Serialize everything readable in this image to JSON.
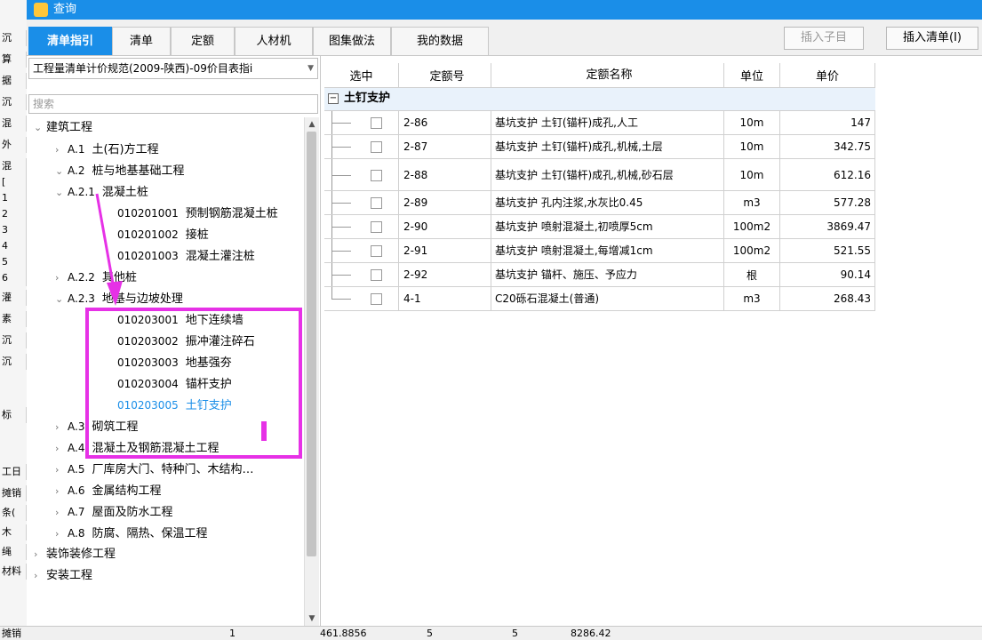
{
  "background": {
    "left_fragments": [
      "沉",
      "算",
      "据",
      "沉",
      "混",
      "外",
      "混",
      "[",
      "1",
      "2",
      "3",
      "4",
      "5",
      "6",
      "灌",
      "素",
      "沉",
      "沉",
      "标",
      "工日",
      "摊销",
      "条(",
      "木",
      "绳",
      "材料"
    ],
    "bottom_row": [
      "摊销",
      "1",
      "461.8856",
      "5",
      "5",
      "8286.42"
    ]
  },
  "dialog": {
    "title": "查询",
    "tabs": [
      "清单指引",
      "清单",
      "定额",
      "人材机",
      "图集做法",
      "我的数据"
    ],
    "active_tab": "清单指引",
    "buttons": {
      "insert_child": "插入子目",
      "insert_list": "插入清单(I)"
    },
    "accent_color": "#1a8ee8",
    "highlight_color": "#e631e6"
  },
  "left": {
    "spec_selected": "工程量清单计价规范(2009-陕西)-09价目表指i",
    "search_placeholder": "搜索",
    "tree": [
      {
        "chev": "⌄",
        "code": "",
        "label": "建筑工程"
      },
      {
        "chev": "›",
        "code": "A.1",
        "label": "土(石)方工程"
      },
      {
        "chev": "⌄",
        "code": "A.2",
        "label": "桩与地基基础工程"
      },
      {
        "chev": "⌄",
        "code": "A.2.1",
        "label": "混凝土桩"
      },
      {
        "chev": "",
        "code": "010201001",
        "label": "预制钢筋混凝土桩"
      },
      {
        "chev": "",
        "code": "010201002",
        "label": "接桩"
      },
      {
        "chev": "",
        "code": "010201003",
        "label": "混凝土灌注桩"
      },
      {
        "chev": "›",
        "code": "A.2.2",
        "label": "其他桩"
      },
      {
        "chev": "⌄",
        "code": "A.2.3",
        "label": "地基与边坡处理"
      },
      {
        "chev": "",
        "code": "010203001",
        "label": "地下连续墙"
      },
      {
        "chev": "",
        "code": "010203002",
        "label": "振冲灌注碎石"
      },
      {
        "chev": "",
        "code": "010203003",
        "label": "地基强夯"
      },
      {
        "chev": "",
        "code": "010203004",
        "label": "锚杆支护"
      },
      {
        "chev": "",
        "code": "010203005",
        "label": "土钉支护"
      },
      {
        "chev": "›",
        "code": "A.3",
        "label": "砌筑工程"
      },
      {
        "chev": "›",
        "code": "A.4",
        "label": "混凝土及钢筋混凝土工程"
      },
      {
        "chev": "›",
        "code": "A.5",
        "label": "厂库房大门、特种门、木结构…"
      },
      {
        "chev": "›",
        "code": "A.6",
        "label": "金属结构工程"
      },
      {
        "chev": "›",
        "code": "A.7",
        "label": "屋面及防水工程"
      },
      {
        "chev": "›",
        "code": "A.8",
        "label": "防腐、隔热、保温工程"
      },
      {
        "chev": "›",
        "code": "",
        "label": "装饰装修工程"
      },
      {
        "chev": "›",
        "code": "",
        "label": "安装工程"
      }
    ]
  },
  "table": {
    "headers": [
      "选中",
      "定额号",
      "定额名称",
      "单位",
      "单价"
    ],
    "group": "土钉支护",
    "rows": [
      {
        "code": "2-86",
        "name": "基坑支护 土钉(锚杆)成孔,人工",
        "unit": "10m",
        "price": "147"
      },
      {
        "code": "2-87",
        "name": "基坑支护 土钉(锚杆)成孔,机械,土层",
        "unit": "10m",
        "price": "342.75"
      },
      {
        "code": "2-88",
        "name": "基坑支护 土钉(锚杆)成孔,机械,砂石层",
        "unit": "10m",
        "price": "612.16"
      },
      {
        "code": "2-89",
        "name": "基坑支护 孔内注浆,水灰比0.45",
        "unit": "m3",
        "price": "577.28"
      },
      {
        "code": "2-90",
        "name": "基坑支护 喷射混凝土,初喷厚5cm",
        "unit": "100m2",
        "price": "3869.47"
      },
      {
        "code": "2-91",
        "name": "基坑支护 喷射混凝土,每增减1cm",
        "unit": "100m2",
        "price": "521.55"
      },
      {
        "code": "2-92",
        "name": "基坑支护 锚杆、施压、予应力",
        "unit": "根",
        "price": "90.14"
      },
      {
        "code": "4-1",
        "name": "C20砾石混凝土(普通)",
        "unit": "m3",
        "price": "268.43"
      }
    ]
  }
}
